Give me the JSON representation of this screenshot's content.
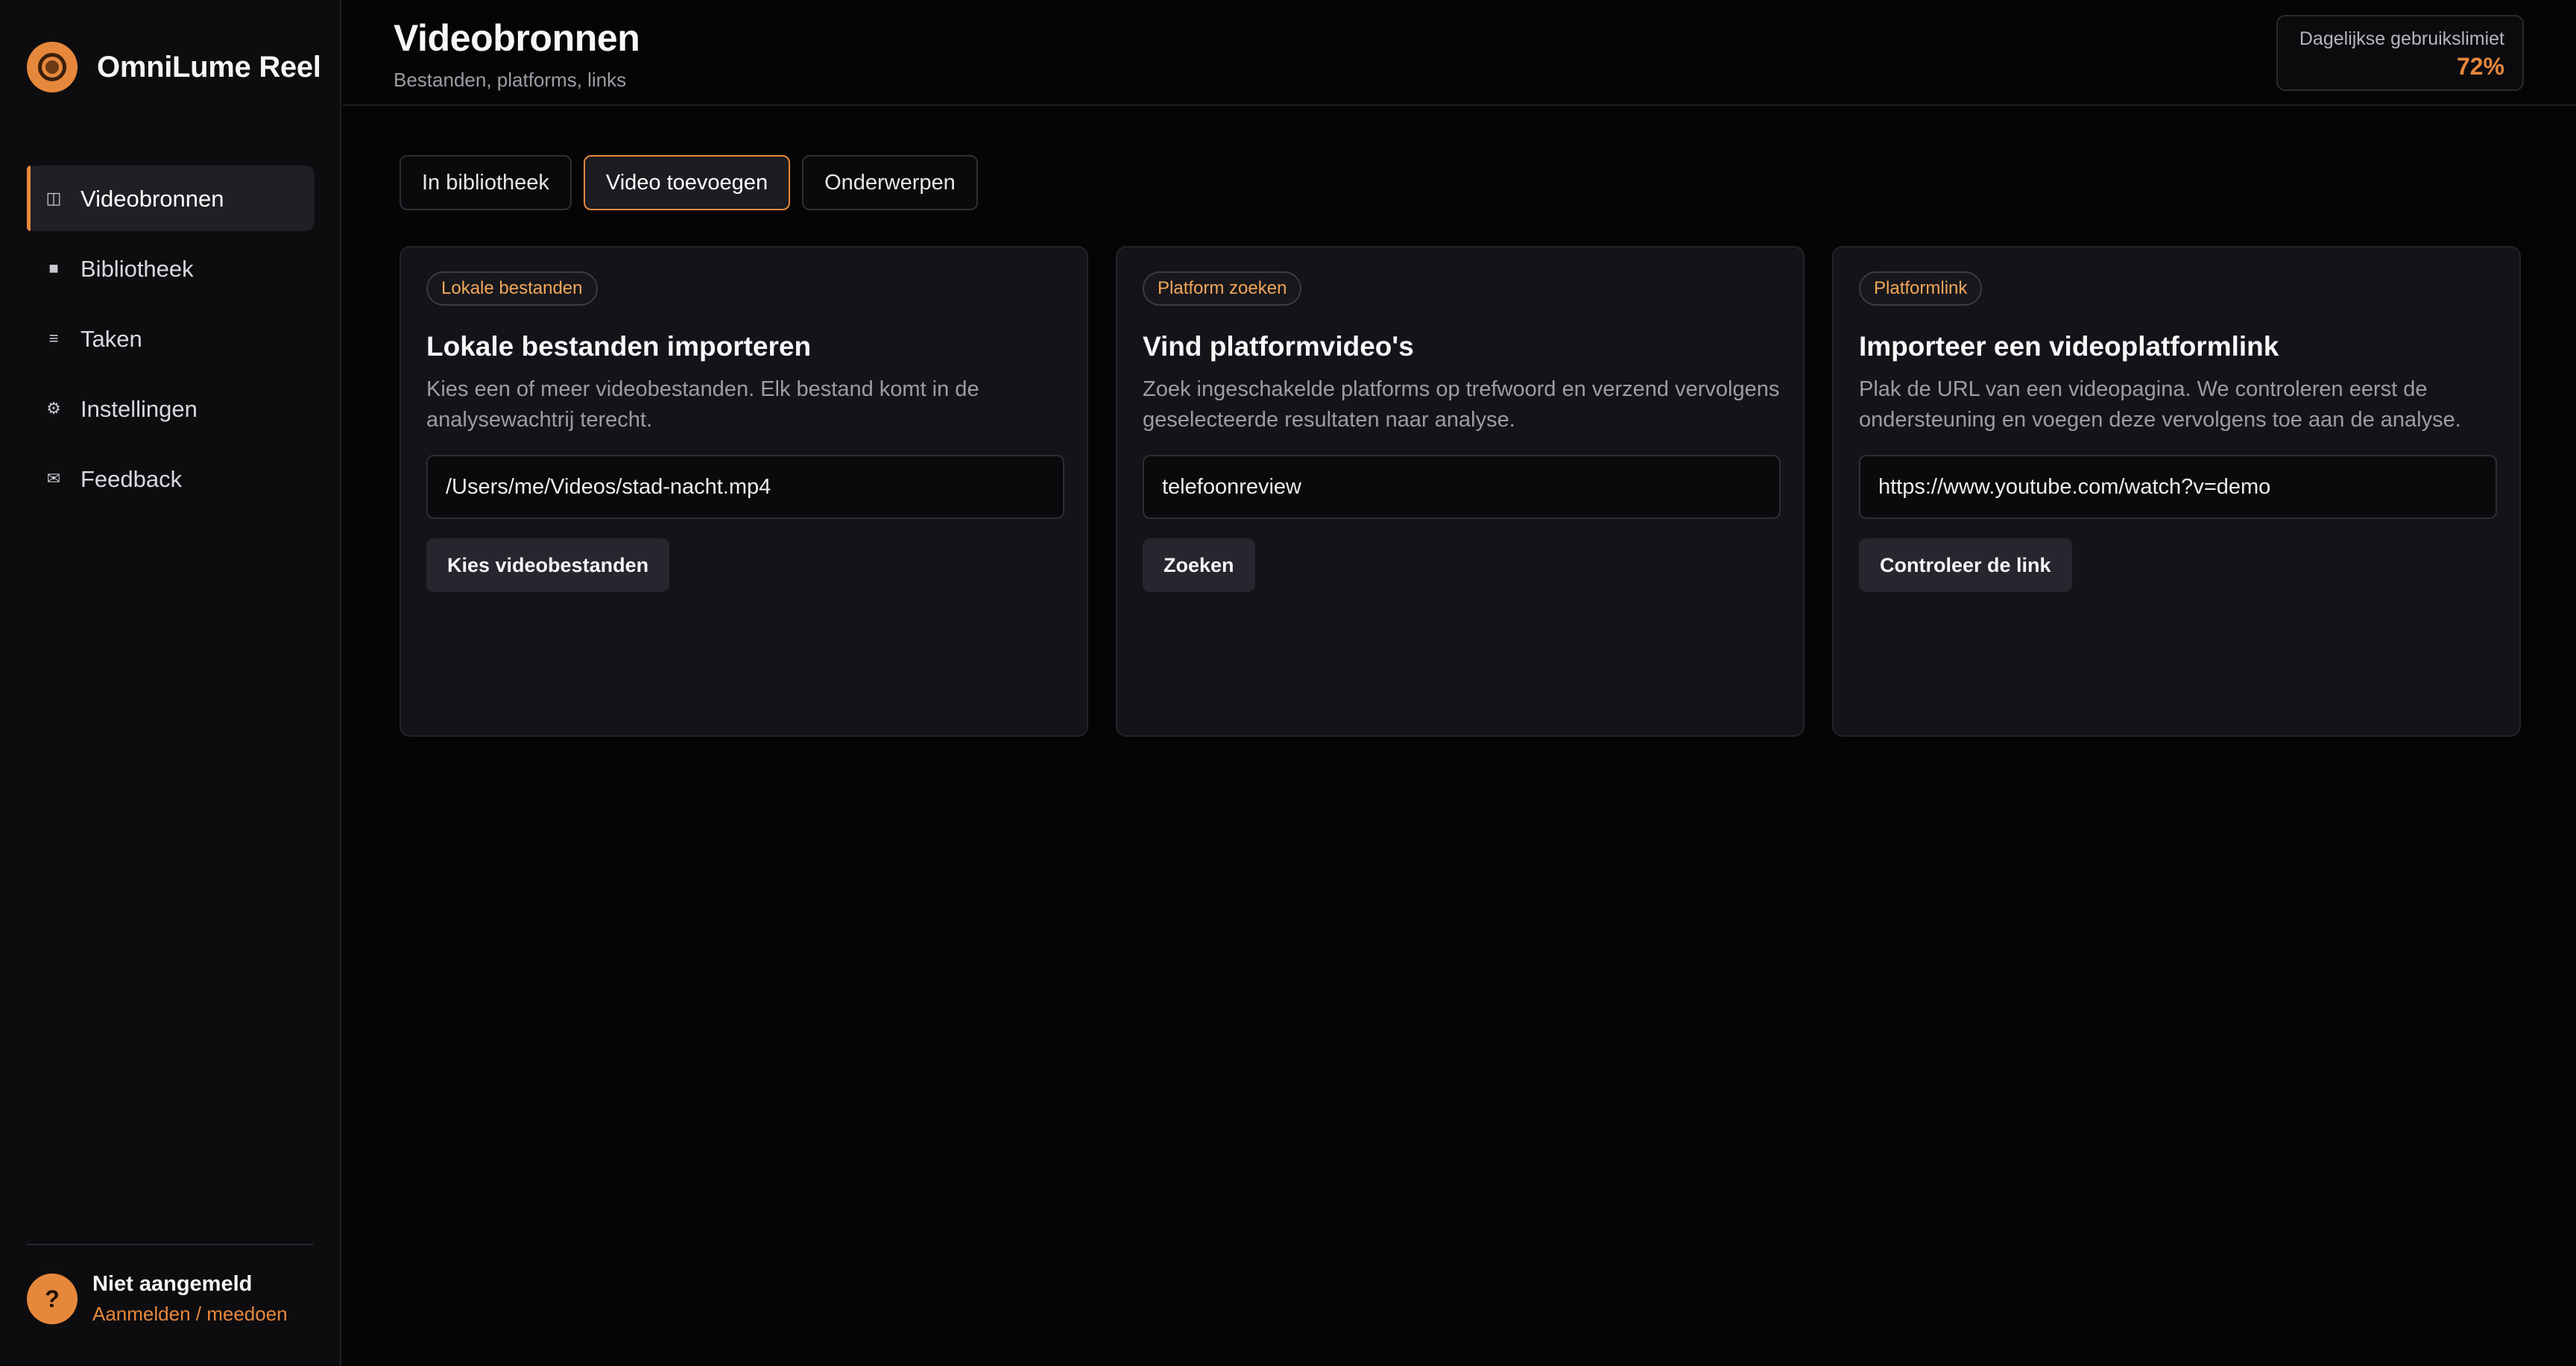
{
  "app": {
    "name": "OmniLume Reel",
    "logo_icon": "reel-logo-icon",
    "accent_color": "#e6883c"
  },
  "sidebar": {
    "items": [
      {
        "label": "Videobronnen",
        "icon": "columns-icon",
        "glyph": "◫",
        "active": true
      },
      {
        "label": "Bibliotheek",
        "icon": "square-icon",
        "glyph": "■",
        "active": false
      },
      {
        "label": "Taken",
        "icon": "list-icon",
        "glyph": "≡",
        "active": false
      },
      {
        "label": "Instellingen",
        "icon": "gear-icon",
        "glyph": "⚙",
        "active": false
      },
      {
        "label": "Feedback",
        "icon": "mail-icon",
        "glyph": "✉",
        "active": false
      }
    ]
  },
  "user": {
    "avatar_glyph": "?",
    "name": "Niet aangemeld",
    "login_link": "Aanmelden / meedoen"
  },
  "header": {
    "title": "Videobronnen",
    "subtitle": "Bestanden, platforms, links",
    "usage_label": "Dagelijkse gebruikslimiet",
    "usage_value": "72%"
  },
  "tabs": [
    {
      "label": "In bibliotheek",
      "active": false
    },
    {
      "label": "Video toevoegen",
      "active": true
    },
    {
      "label": "Onderwerpen",
      "active": false
    }
  ],
  "cards": [
    {
      "badge": "Lokale bestanden",
      "title": "Lokale bestanden importeren",
      "description": "Kies een of meer videobestanden. Elk bestand komt in de analysewachtrij terecht.",
      "input_value": "/Users/me/Videos/stad-nacht.mp4",
      "button_label": "Kies videobestanden"
    },
    {
      "badge": "Platform zoeken",
      "title": "Vind platformvideo's",
      "description": "Zoek ingeschakelde platforms op trefwoord en verzend vervolgens geselecteerde resultaten naar analyse.",
      "input_value": "telefoonreview",
      "button_label": "Zoeken"
    },
    {
      "badge": "Platformlink",
      "title": "Importeer een videoplatformlink",
      "description": "Plak de URL van een videopagina. We controleren eerst de ondersteuning en voegen deze vervolgens toe aan de analyse.",
      "input_value": "https://www.youtube.com/watch?v=demo",
      "button_label": "Controleer de link"
    }
  ]
}
